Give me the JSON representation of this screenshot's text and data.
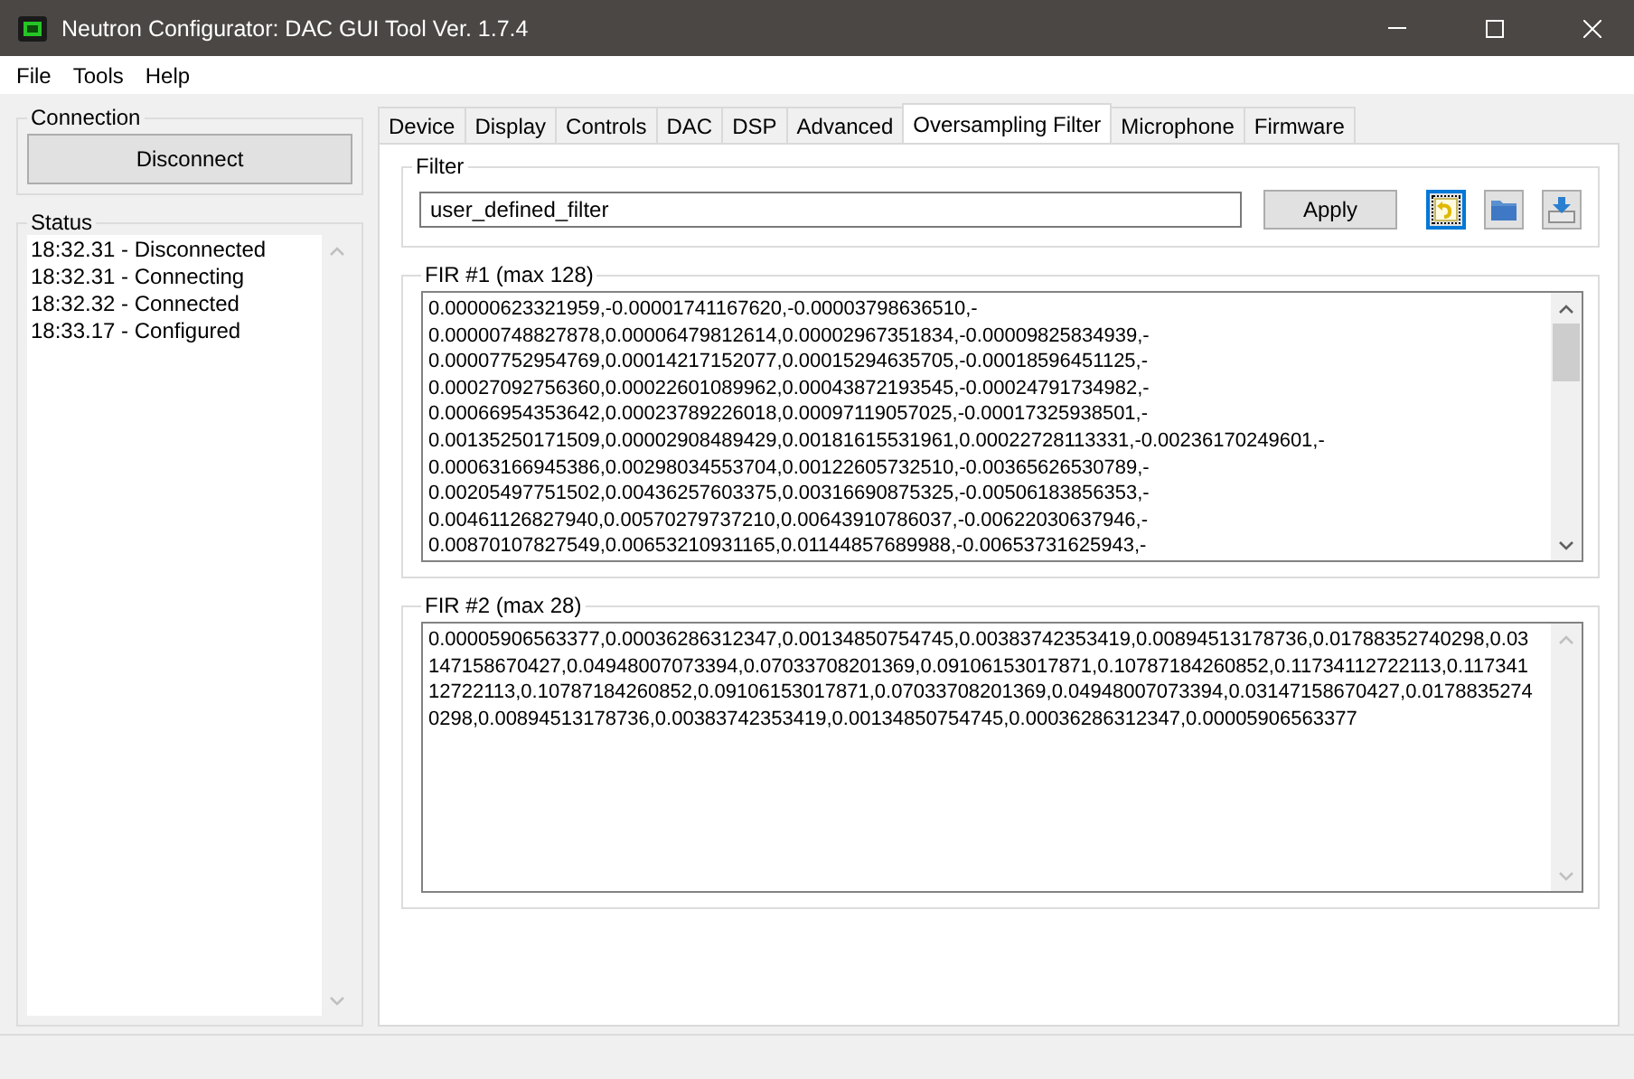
{
  "window": {
    "title": "Neutron Configurator: DAC GUI Tool Ver. 1.7.4"
  },
  "menu": [
    "File",
    "Tools",
    "Help"
  ],
  "connection": {
    "title": "Connection",
    "button": "Disconnect"
  },
  "status": {
    "title": "Status",
    "entries": [
      "18:32.31 - Disconnected",
      "18:32.31 - Connecting",
      "18:32.32 - Connected",
      "18:33.17 - Configured"
    ]
  },
  "tabs": [
    {
      "label": "Device",
      "selected": false
    },
    {
      "label": "Display",
      "selected": false
    },
    {
      "label": "Controls",
      "selected": false
    },
    {
      "label": "DAC",
      "selected": false
    },
    {
      "label": "DSP",
      "selected": false
    },
    {
      "label": "Advanced",
      "selected": false
    },
    {
      "label": "Oversampling Filter",
      "selected": true
    },
    {
      "label": "Microphone",
      "selected": false
    },
    {
      "label": "Firmware",
      "selected": false
    }
  ],
  "filter": {
    "title": "Filter",
    "value": "user_defined_filter",
    "apply": "Apply",
    "tools": [
      {
        "kind": "undo",
        "focused": true
      },
      {
        "kind": "open",
        "focused": false
      },
      {
        "kind": "save",
        "focused": false
      }
    ]
  },
  "fir1": {
    "title": "FIR #1 (max 128)",
    "lines": [
      "0.00000623321959,-0.00001741167620,-0.00003798636510,-",
      "0.00000748827878,0.00006479812614,0.00002967351834,-0.00009825834939,-",
      "0.00007752954769,0.00014217152077,0.00015294635705,-0.00018596451125,-",
      "0.00027092756360,0.00022601089962,0.00043872193545,-0.00024791734982,-",
      "0.00066954353642,0.00023789226018,0.00097119057025,-0.00017325938501,-",
      "0.00135250171509,0.00002908489429,0.00181615531961,0.00022728113331,-0.00236170249601,-",
      "0.00063166945386,0.00298034553704,0.00122605732510,-0.00365626530789,-",
      "0.00205497751502,0.00436257603375,0.00316690875325,-0.00506183856353,-",
      "0.00461126827940,0.00570279737210,0.00643910786037,-0.00622030637946,-",
      "0.00870107827549,0.00653210931165,0.01144857689988,-0.00653731625943,-"
    ]
  },
  "fir2": {
    "title": "FIR #2 (max 28)",
    "lines": [
      "0.00005906563377,0.00036286312347,0.00134850754745,0.00383742353419,0.00894513178736,0.01788352740298,0.03",
      "147158670427,0.04948007073394,0.07033708201369,0.09106153017871,0.10787184260852,0.11734112722113,0.117341",
      "12722113,0.10787184260852,0.09106153017871,0.07033708201369,0.04948007073394,0.03147158670427,0.0178835274",
      "0298,0.00894513178736,0.00383742353419,0.00134850754745,0.00036286312347,0.00005906563377"
    ]
  }
}
